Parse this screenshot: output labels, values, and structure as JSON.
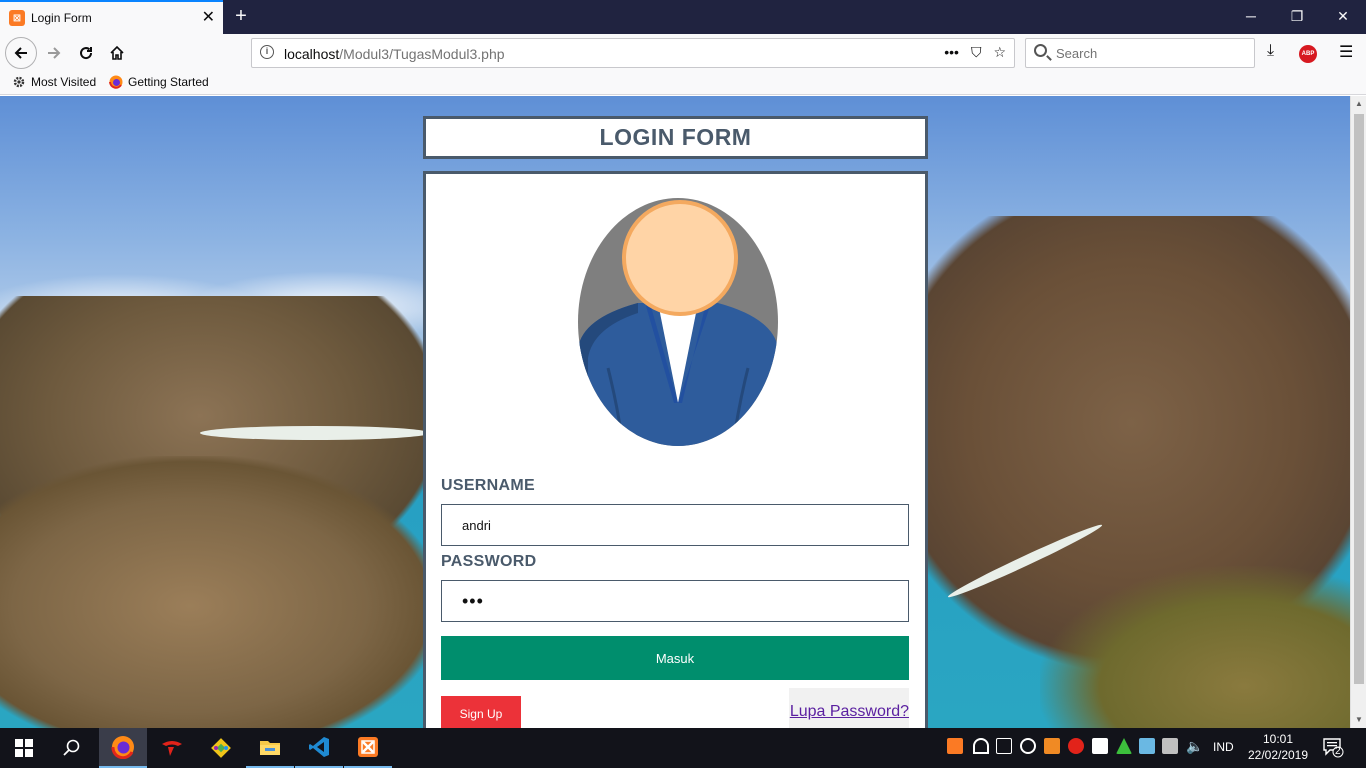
{
  "browser": {
    "tab_title": "Login Form",
    "tab_icon_glyph": "ꟹ",
    "url_host": "localhost",
    "url_path": "/Modul3/TugasModul3.php",
    "search_placeholder": "Search",
    "abp_label": "ABP",
    "bookmarks": [
      {
        "label": "Most Visited",
        "icon": "gear-icon"
      },
      {
        "label": "Getting Started",
        "icon": "firefox-icon"
      }
    ]
  },
  "page": {
    "header_title": "LOGIN FORM",
    "username_label": "USERNAME",
    "username_value": "andri",
    "password_label": "PASSWORD",
    "password_value": "abc",
    "login_button": "Masuk",
    "signup_button": "Sign Up",
    "forgot_link": "Lupa Password?"
  },
  "taskbar": {
    "language": "IND",
    "time": "10:01",
    "date": "22/02/2019",
    "notification_count": "2",
    "apps": [
      "windows-start-icon",
      "search-icon",
      "firefox-icon",
      "game-app-icon",
      "git-app-icon",
      "file-explorer-icon",
      "vscode-icon",
      "xampp-icon"
    ]
  },
  "colors": {
    "form_border": "#4a5a6b",
    "login_button": "#008e6d",
    "signup_button": "#ec3239",
    "forgot_link": "#5a1fa0"
  }
}
